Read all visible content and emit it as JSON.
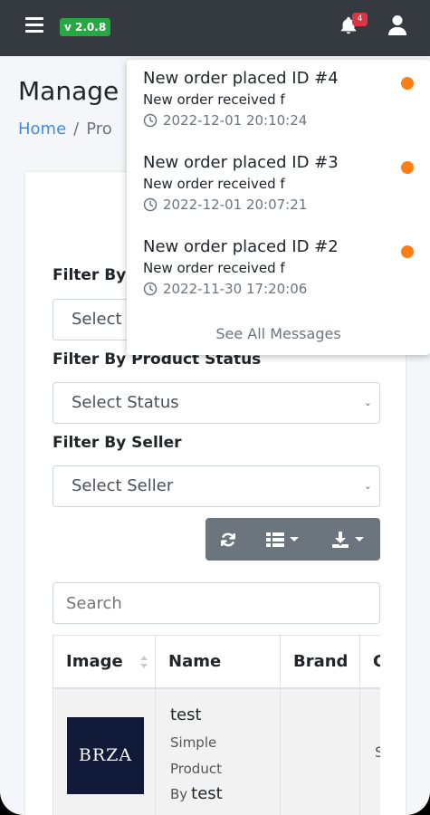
{
  "header": {
    "version": "v 2.0.8",
    "notification_count": "4"
  },
  "page": {
    "title": "Manage",
    "breadcrumb_home": "Home",
    "breadcrumb_separator": "/",
    "breadcrumb_current": "Pro"
  },
  "filters": {
    "category_label": "Filter By",
    "category_select": "Select C",
    "status_label": "Filter By Product Status",
    "status_select": "Select Status",
    "seller_label": "Filter By Seller",
    "seller_select": "Select Seller"
  },
  "toolbar": {
    "refresh_icon": "refresh-icon",
    "columns_icon": "list-columns-icon",
    "export_icon": "download-icon"
  },
  "search": {
    "placeholder": "Search"
  },
  "table": {
    "columns": [
      "Image",
      "Name",
      "Brand",
      "C"
    ],
    "rows": [
      {
        "image_text": "BRZA",
        "name": "test",
        "type_line1": "Simple",
        "type_line2": "Product",
        "by_label": "By",
        "seller": "test",
        "brand": "",
        "category": "S"
      }
    ]
  },
  "notifications": {
    "dot_color": "#fd7e14",
    "items": [
      {
        "title": "New order placed ID #4",
        "body": "New order received f",
        "time": "2022-12-01 20:10:24"
      },
      {
        "title": "New order placed ID #3",
        "body": "New order received f",
        "time": "2022-12-01 20:07:21"
      },
      {
        "title": "New order placed ID #2",
        "body": "New order received f",
        "time": "2022-11-30 17:20:06"
      }
    ],
    "see_all": "See All Messages"
  }
}
